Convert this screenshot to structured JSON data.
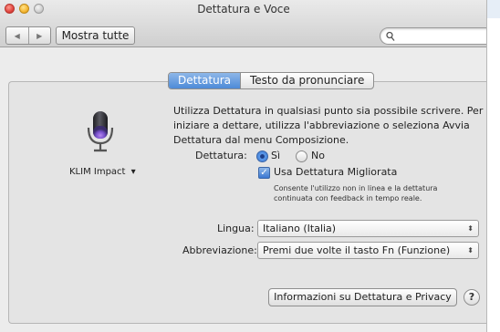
{
  "window": {
    "title": "Dettatura e Voce"
  },
  "toolbar": {
    "back_glyph": "◀",
    "forward_glyph": "▶",
    "show_all_label": "Mostra tutte",
    "search_placeholder": ""
  },
  "tabs": [
    {
      "label": "Dettatura",
      "active": true
    },
    {
      "label": "Testo da pronunciare",
      "active": false
    }
  ],
  "microphone": {
    "source_label": "KLIM Impact",
    "dropdown_glyph": "▾"
  },
  "description": "Utilizza Dettatura in qualsiasi punto sia possibile scrivere. Per iniziare a dettare, utilizza l'abbreviazione o seleziona Avvia Dettatura dal menu Composizione.",
  "dictation": {
    "label": "Dettatura:",
    "options": [
      {
        "label": "Sì",
        "selected": true
      },
      {
        "label": "No",
        "selected": false
      }
    ]
  },
  "enhanced": {
    "label": "Usa Dettatura Migliorata",
    "checked": true,
    "check_glyph": "✓",
    "note": "Consente l'utilizzo non in linea e la dettatura continuata con feedback in tempo reale."
  },
  "language": {
    "label": "Lingua:",
    "value": "Italiano (Italia)"
  },
  "shortcut": {
    "label": "Abbreviazione:",
    "value": "Premi due volte il tasto Fn (Funzione)"
  },
  "select_arrows": "⬍",
  "buttons": {
    "info_label": "Informazioni su Dettatura e Privacy",
    "help_label": "?"
  },
  "colors": {
    "accent": "#4d8ad8",
    "window_bg": "#ececec"
  }
}
